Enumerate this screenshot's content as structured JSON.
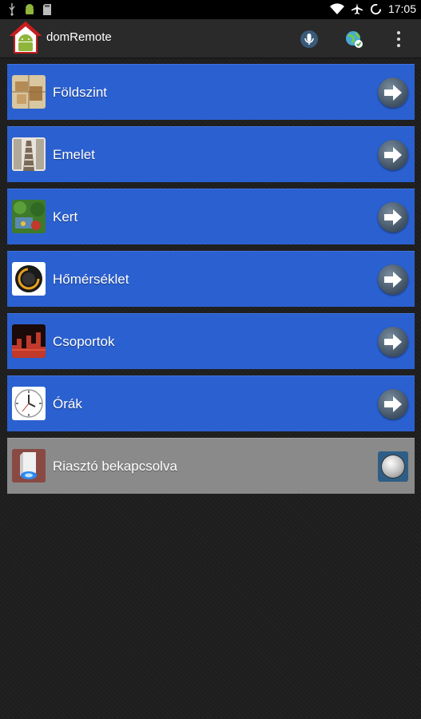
{
  "status_bar": {
    "time": "17:05",
    "icons": [
      "usb-icon",
      "android-debug-icon",
      "sd-card-icon",
      "wifi-icon",
      "airplane-icon",
      "sync-icon"
    ]
  },
  "action_bar": {
    "title": "domRemote",
    "actions": [
      "microphone-icon",
      "network-globe-icon",
      "overflow-menu-icon"
    ]
  },
  "menu": {
    "items": [
      {
        "label": "Földszint",
        "icon": "ground-floor-icon"
      },
      {
        "label": "Emelet",
        "icon": "upper-floor-icon"
      },
      {
        "label": "Kert",
        "icon": "garden-icon"
      },
      {
        "label": "Hőmérséklet",
        "icon": "temperature-gauge-icon"
      },
      {
        "label": "Csoportok",
        "icon": "groups-icon"
      },
      {
        "label": "Órák",
        "icon": "clock-icon"
      }
    ],
    "alarm": {
      "label": "Riasztó bekapcsolva",
      "icon": "alarm-siren-icon"
    }
  },
  "colors": {
    "row_blue": "#2b60d0",
    "row_grey": "#8a8a8a",
    "background": "#1d1d1d"
  }
}
